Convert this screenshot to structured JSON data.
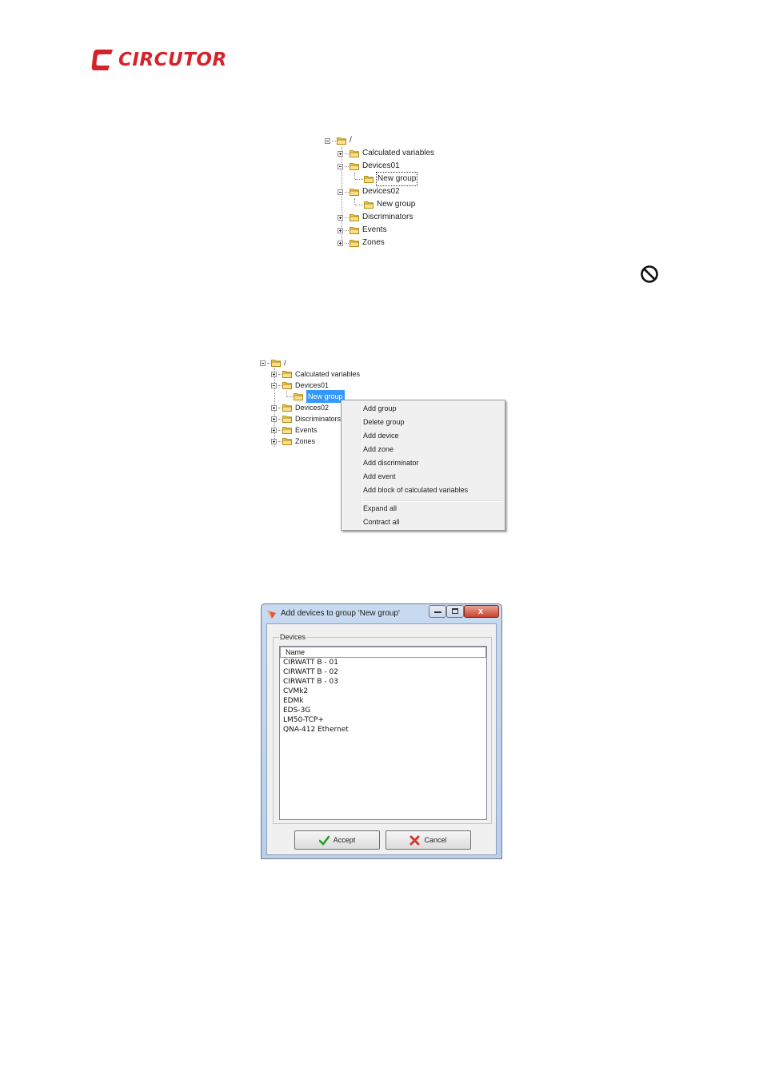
{
  "brand": {
    "name": "CIRCUTOR",
    "color": "#d6232b"
  },
  "tree1": {
    "root": "/",
    "items": [
      {
        "label": "Calculated variables"
      },
      {
        "label": "Devices01"
      },
      {
        "label": "New group"
      },
      {
        "label": "Devices02"
      },
      {
        "label": "New group"
      },
      {
        "label": "Discriminators"
      },
      {
        "label": "Events"
      },
      {
        "label": "Zones"
      }
    ]
  },
  "icons": {
    "noentry": "no-entry-icon",
    "folder": "folder-icon"
  },
  "tree2": {
    "root": "/",
    "items": [
      {
        "label": "Calculated variables"
      },
      {
        "label": "Devices01"
      },
      {
        "label": "New group"
      },
      {
        "label": "Devices02"
      },
      {
        "label": "Discriminators"
      },
      {
        "label": "Events"
      },
      {
        "label": "Zones"
      }
    ]
  },
  "context_menu": {
    "items": [
      "Add group",
      "Delete group",
      "Add device",
      "Add zone",
      "Add discriminator",
      "Add event",
      "Add block of calculated variables",
      "Expand all",
      "Contract all"
    ]
  },
  "dialog": {
    "title": "Add devices to group 'New group'",
    "group_label": "Devices",
    "column": "Name",
    "devices": [
      "CIRWATT B - 01",
      "CIRWATT B - 02",
      "CIRWATT B - 03",
      "CVMk2",
      "EDMk",
      "EDS-3G",
      "LM50-TCP+",
      "QNA-412 Ethernet"
    ],
    "accept": "Accept",
    "cancel": "Cancel",
    "close_symbol": "x"
  }
}
